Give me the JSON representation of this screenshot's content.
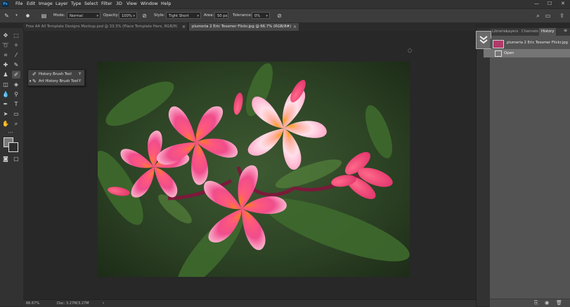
{
  "app_icon": "photoshop-logo",
  "menu": [
    "File",
    "Edit",
    "Image",
    "Layer",
    "Type",
    "Select",
    "Filter",
    "3D",
    "View",
    "Window",
    "Help"
  ],
  "options_bar": {
    "mode_label": "Mode:",
    "mode_value": "Normal",
    "opacity_label": "Opacity:",
    "opacity_value": "100%",
    "style_label": "Style:",
    "style_value": "Tight Short",
    "area_label": "Area:",
    "area_value": "50 px",
    "tolerance_label": "Tolerance:",
    "tolerance_value": "0%"
  },
  "tabs": [
    {
      "label": "Free A4 All Template Designs Mockup.psd @ 33.3% (Place Template Here, RGB/8)",
      "active": false
    },
    {
      "label": "plumeria 2 Eric Tessmer Flickr.jpg @ 66.7% (RGB/8#)",
      "active": true
    }
  ],
  "flyout": [
    {
      "label": "History Brush Tool",
      "shortcut": "Y",
      "current": false
    },
    {
      "label": "Art History Brush Tool",
      "shortcut": "Y",
      "current": true
    }
  ],
  "status": {
    "zoom": "66.67%",
    "doc": "Doc: 3.27M/3.27M"
  },
  "panel_tabs": [
    "Libraries",
    "Layers",
    "Channels",
    "History"
  ],
  "history": {
    "snapshot_label": "plumeria 2 Eric Tessmer Flickr.jpg",
    "states": [
      "Open"
    ]
  },
  "colors": {
    "accent": "#31a8ff",
    "panel": "#535353",
    "bg": "#282828"
  }
}
